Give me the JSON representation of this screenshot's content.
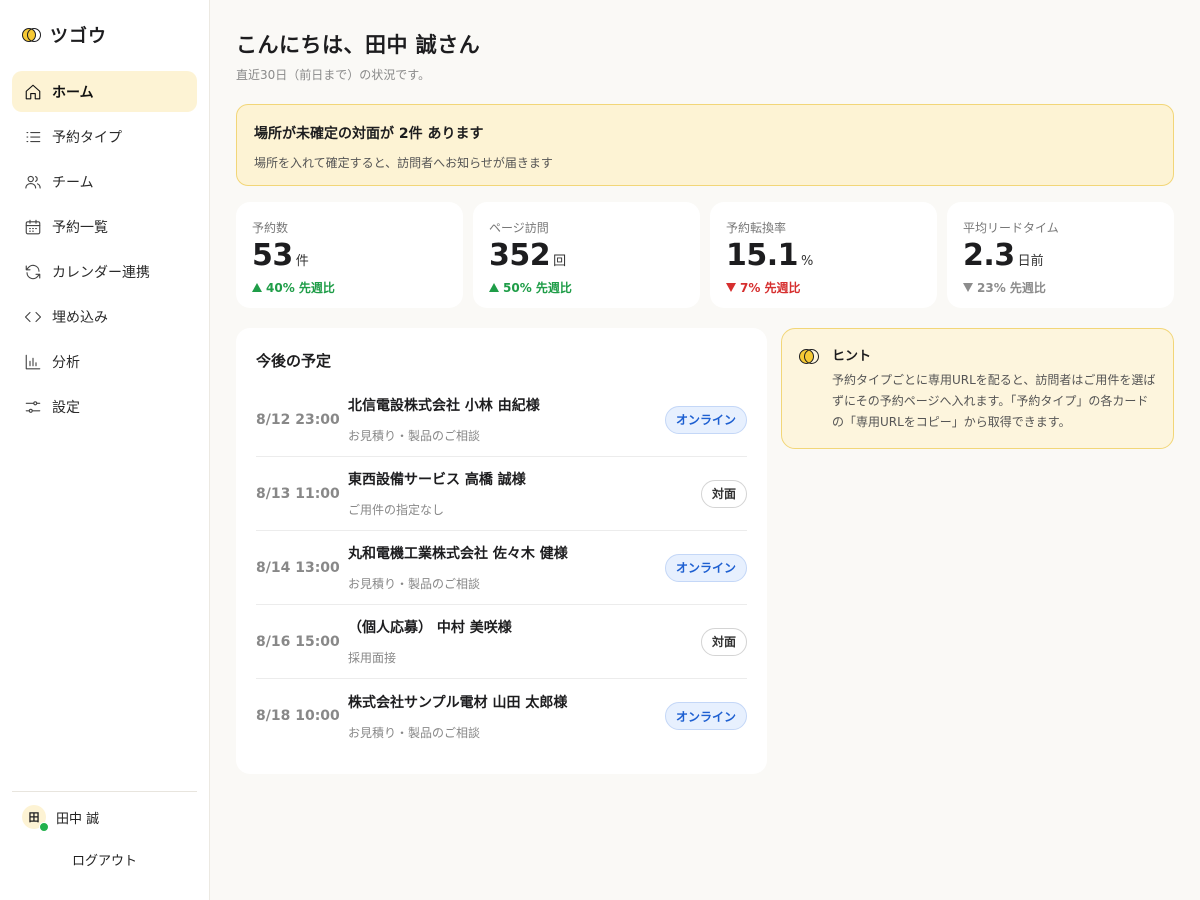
{
  "app": {
    "name": "ツゴウ"
  },
  "sidebar": {
    "items": [
      {
        "label": "ホーム",
        "icon": "home-icon",
        "active": true
      },
      {
        "label": "予約タイプ",
        "icon": "list-icon",
        "active": false
      },
      {
        "label": "チーム",
        "icon": "users-icon",
        "active": false
      },
      {
        "label": "予約一覧",
        "icon": "calendar-icon",
        "active": false
      },
      {
        "label": "カレンダー連携",
        "icon": "sync-icon",
        "active": false
      },
      {
        "label": "埋め込み",
        "icon": "code-icon",
        "active": false
      },
      {
        "label": "分析",
        "icon": "bar-chart-icon",
        "active": false
      },
      {
        "label": "設定",
        "icon": "sliders-icon",
        "active": false
      }
    ],
    "user": {
      "avatar": "田",
      "name": "田中 誠",
      "status": "online"
    },
    "logout_label": "ログアウト"
  },
  "header": {
    "greeting": "こんにちは、田中 誠さん",
    "subtitle": "直近30日（前日まで）の状況です。"
  },
  "alert": {
    "title": "場所が未確定の対面が 2件 あります",
    "text": "場所を入れて確定すると、訪問者へお知らせが届きます"
  },
  "stats": [
    {
      "label": "予約数",
      "value": "53",
      "unit": "件",
      "delta": "40% 先週比",
      "trend": "up"
    },
    {
      "label": "ページ訪問",
      "value": "352",
      "unit": "回",
      "delta": "50% 先週比",
      "trend": "up"
    },
    {
      "label": "予約転換率",
      "value": "15.1",
      "unit": "%",
      "delta": "7% 先週比",
      "trend": "down"
    },
    {
      "label": "平均リードタイム",
      "value": "2.3",
      "unit": "日前",
      "delta": "23% 先週比",
      "trend": "flat"
    }
  ],
  "schedule": {
    "title": "今後の予定",
    "events": [
      {
        "time": "8/12 23:00",
        "name": "北信電設株式会社 小林 由紀様",
        "sub": "お見積り・製品のご相談",
        "badge": "オンライン",
        "type": "online"
      },
      {
        "time": "8/13 11:00",
        "name": "東西設備サービス 高橋 誠様",
        "sub": "ご用件の指定なし",
        "badge": "対面",
        "type": "offline"
      },
      {
        "time": "8/14 13:00",
        "name": "丸和電機工業株式会社 佐々木 健様",
        "sub": "お見積り・製品のご相談",
        "badge": "オンライン",
        "type": "online"
      },
      {
        "time": "8/16 15:00",
        "name": "（個人応募） 中村 美咲様",
        "sub": "採用面接",
        "badge": "対面",
        "type": "offline"
      },
      {
        "time": "8/18 10:00",
        "name": "株式会社サンプル電材 山田 太郎様",
        "sub": "お見積り・製品のご相談",
        "badge": "オンライン",
        "type": "online"
      }
    ]
  },
  "hint": {
    "title": "ヒント",
    "text": "予約タイプごとに専用URLを配ると、訪問者はご用件を選ばずにその予約ページへ入れます。「予約タイプ」の各カードの「専用URLをコピー」から取得できます。"
  },
  "colors": {
    "accent": "#f6c935",
    "accent_bg": "#fdf3d4",
    "up": "#1f9d48",
    "down": "#d62f2f",
    "online_badge": "#1d5fd1"
  }
}
